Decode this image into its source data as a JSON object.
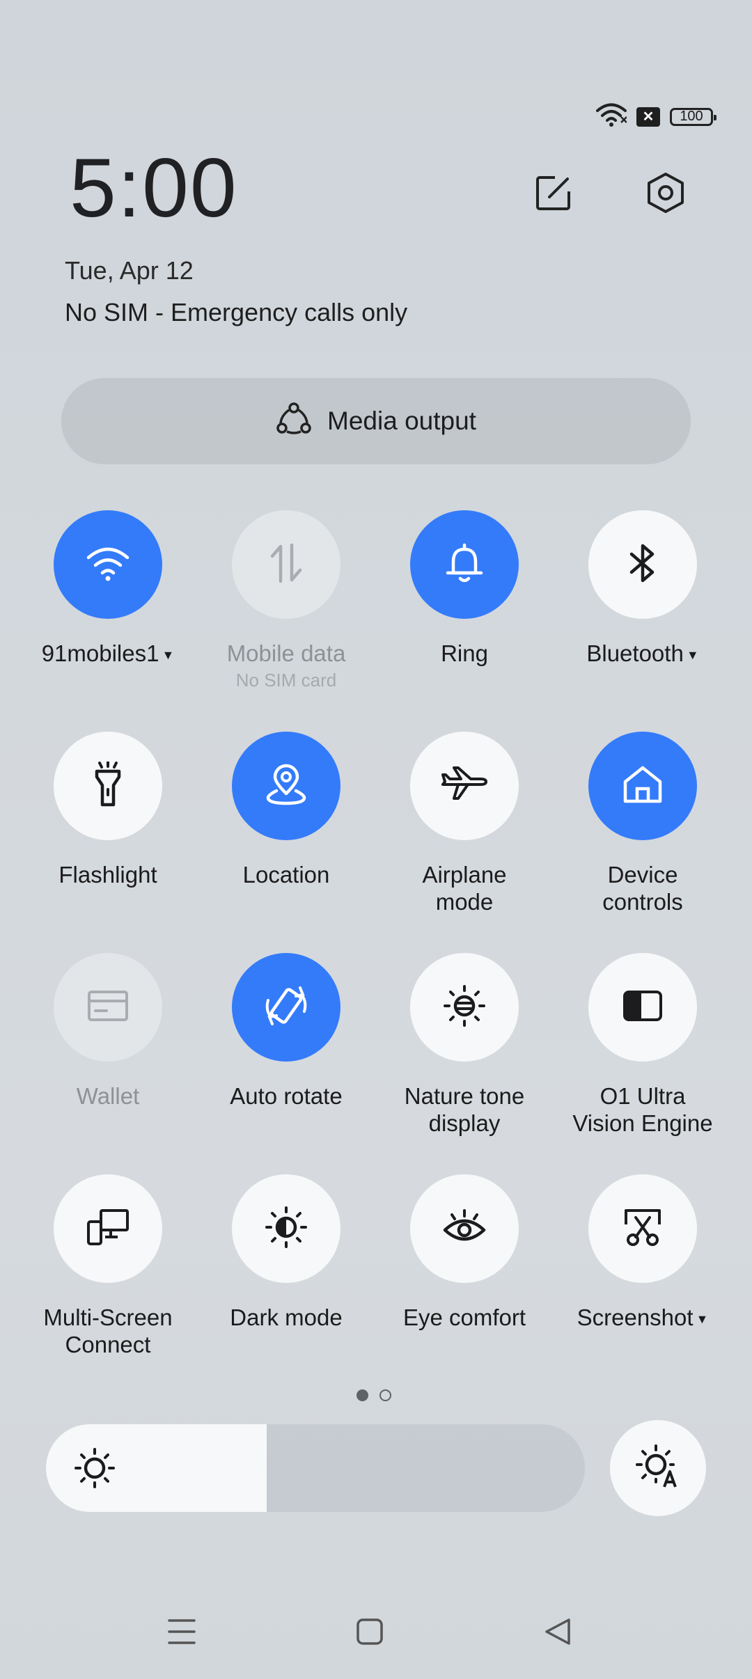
{
  "status_bar": {
    "battery": "100",
    "sim_icon": "no-sim-icon",
    "wifi_icon": "wifi-signal-icon"
  },
  "header": {
    "time": "5:00",
    "date": "Tue, Apr 12",
    "sim_status": "No SIM - Emergency calls only",
    "edit_icon": "edit-icon",
    "settings_icon": "settings-icon"
  },
  "media_output": {
    "label": "Media output",
    "icon": "media-output-icon"
  },
  "tiles": [
    {
      "label": "91mobiles1",
      "state": "on",
      "icon": "wifi-icon",
      "has_dropdown": true
    },
    {
      "label": "Mobile data",
      "sublabel": "No SIM card",
      "state": "disabled",
      "icon": "mobile-data-icon"
    },
    {
      "label": "Ring",
      "state": "on",
      "icon": "bell-icon"
    },
    {
      "label": "Bluetooth",
      "state": "off",
      "icon": "bluetooth-icon",
      "has_dropdown": true
    },
    {
      "label": "Flashlight",
      "state": "off",
      "icon": "flashlight-icon"
    },
    {
      "label": "Location",
      "state": "on",
      "icon": "location-icon"
    },
    {
      "label": "Airplane\nmode",
      "state": "off",
      "icon": "airplane-icon"
    },
    {
      "label": "Device\ncontrols",
      "state": "on",
      "icon": "home-icon"
    },
    {
      "label": "Wallet",
      "state": "disabled",
      "icon": "wallet-icon"
    },
    {
      "label": "Auto rotate",
      "state": "on",
      "icon": "auto-rotate-icon"
    },
    {
      "label": "Nature tone\ndisplay",
      "state": "off",
      "icon": "nature-tone-icon"
    },
    {
      "label": "O1 Ultra\nVision Engine",
      "state": "off",
      "icon": "vision-engine-icon"
    },
    {
      "label": "Multi-Screen\nConnect",
      "state": "off",
      "icon": "multi-screen-icon"
    },
    {
      "label": "Dark mode",
      "state": "off",
      "icon": "dark-mode-icon"
    },
    {
      "label": "Eye comfort",
      "state": "off",
      "icon": "eye-icon"
    },
    {
      "label": "Screenshot",
      "state": "off",
      "icon": "screenshot-icon",
      "has_dropdown": true
    }
  ],
  "pager": {
    "current": 1,
    "total": 2
  },
  "brightness": {
    "level": 0.41,
    "icon": "brightness-icon",
    "auto_icon": "auto-brightness-icon"
  },
  "navigation": {
    "menu_icon": "recents-icon",
    "home_icon": "home-button-icon",
    "back_icon": "back-icon"
  },
  "colors": {
    "accent": "#347bfa",
    "tile_off": "#f7f8f9",
    "tile_disabled": "#e3e6e9"
  }
}
